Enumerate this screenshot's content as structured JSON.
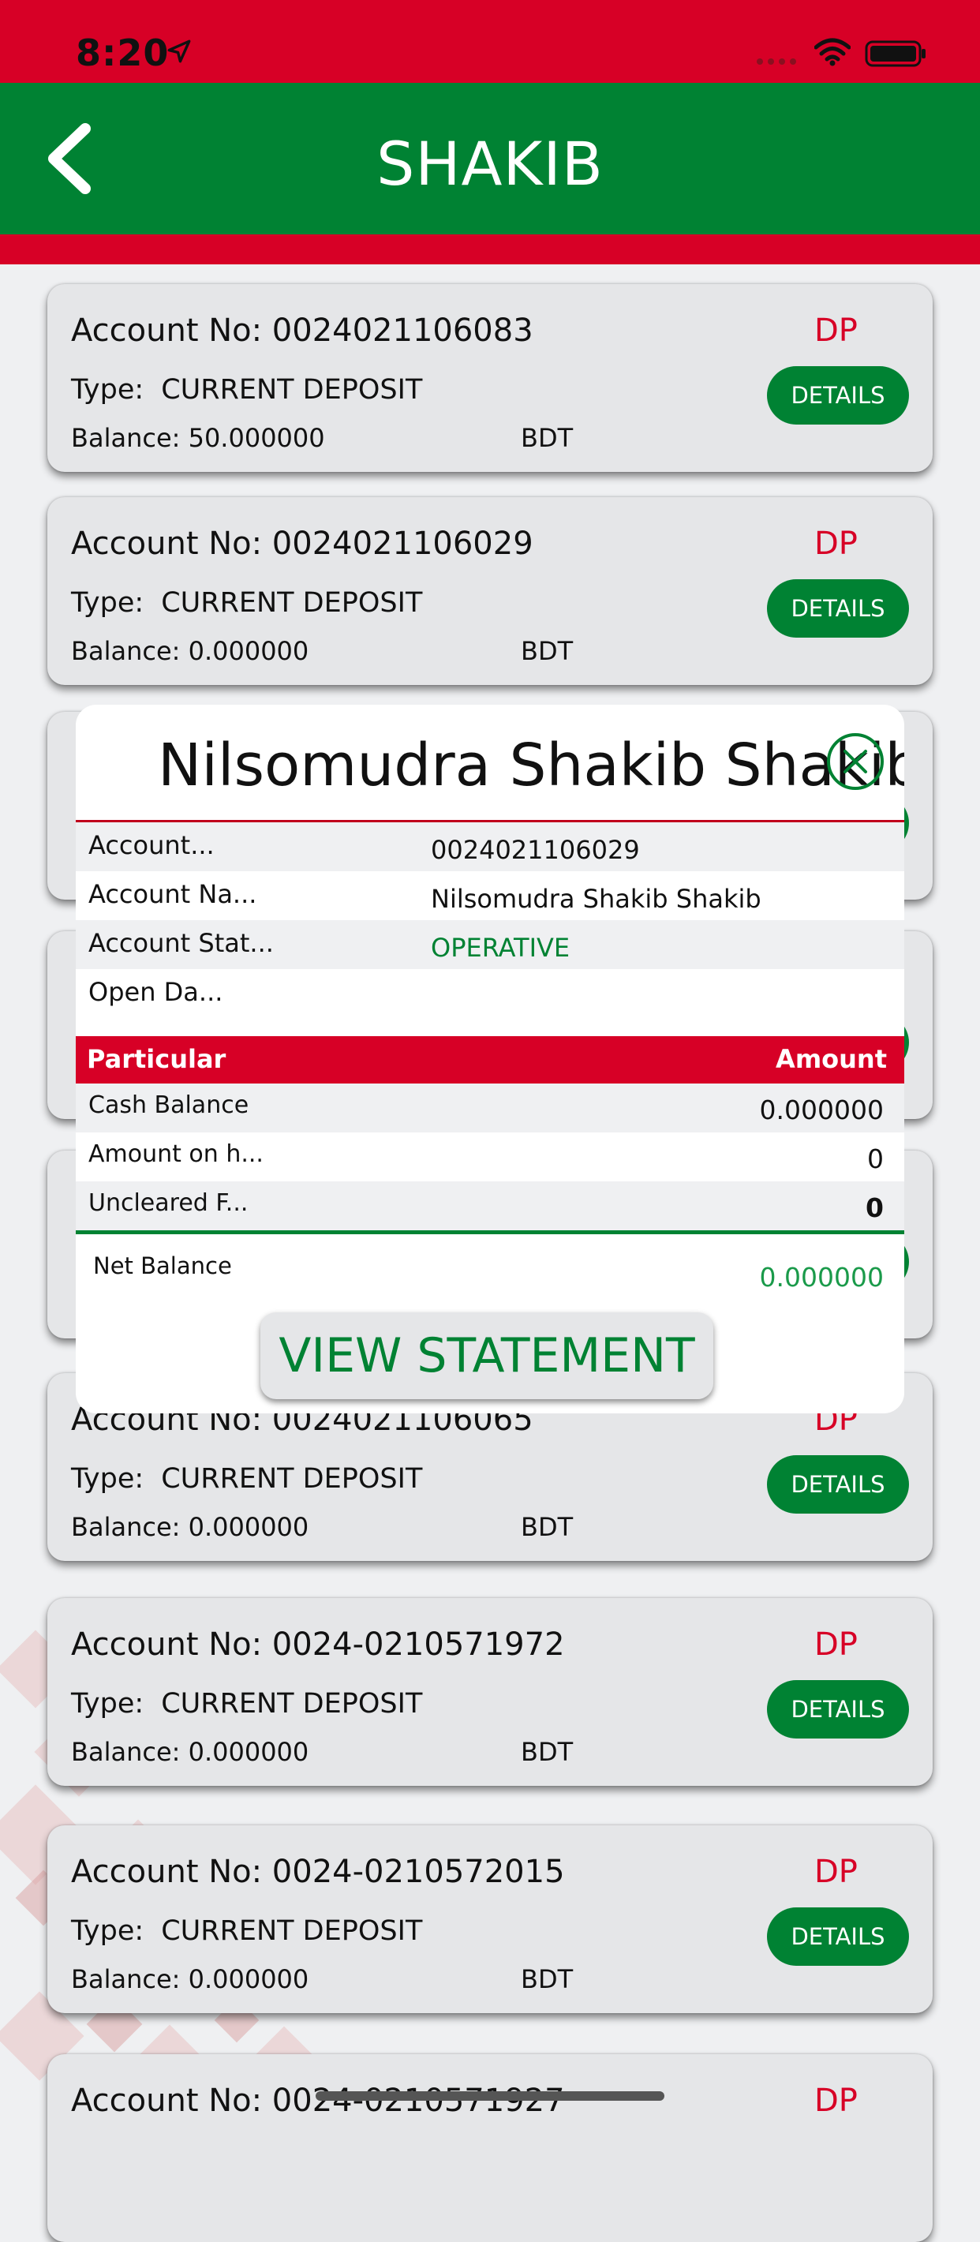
{
  "status_bar": {
    "time": "8:20"
  },
  "nav": {
    "title": "SHAKIB"
  },
  "accounts": [
    {
      "account_no": "Account No: 0024021106083",
      "type_label": "Type:",
      "type_value": "CURRENT DEPOSIT",
      "balance": "Balance: 50.000000",
      "currency": "BDT",
      "badge": "DP",
      "button": "DETAILS"
    },
    {
      "account_no": "Account No: 0024021106029",
      "type_label": "Type:",
      "type_value": "CURRENT DEPOSIT",
      "balance": "Balance: 0.000000",
      "currency": "BDT",
      "badge": "DP",
      "button": "DETAILS"
    },
    {
      "account_no": "Account No: 0024021106065",
      "type_label": "Type:",
      "type_value": "CURRENT DEPOSIT",
      "balance": "Balance: 0.000000",
      "currency": "BDT",
      "badge": "DP",
      "button": "DETAILS"
    },
    {
      "account_no": "Account No: 0024-0210571972",
      "type_label": "Type:",
      "type_value": "CURRENT DEPOSIT",
      "balance": "Balance: 0.000000",
      "currency": "BDT",
      "badge": "DP",
      "button": "DETAILS"
    },
    {
      "account_no": "Account No: 0024-0210572015",
      "type_label": "Type:",
      "type_value": "CURRENT DEPOSIT",
      "balance": "Balance: 0.000000",
      "currency": "BDT",
      "badge": "DP",
      "button": "DETAILS"
    },
    {
      "account_no": "Account No: 0024-0210571927",
      "badge": "DP"
    }
  ],
  "modal": {
    "title": "Nilsomudra Shakib Shakib",
    "info": [
      {
        "key": "Account...",
        "value": "0024021106029"
      },
      {
        "key": "Account Na...",
        "value": "Nilsomudra Shakib Shakib"
      },
      {
        "key": "Account Stat...",
        "value": "OPERATIVE"
      },
      {
        "key": "Open Da...",
        "value": ""
      }
    ],
    "table_header": {
      "particular": "Particular",
      "amount": "Amount"
    },
    "amounts": [
      {
        "key": "Cash Balance",
        "value": "0.000000"
      },
      {
        "key": "Amount on h...",
        "value": "0"
      },
      {
        "key": "Uncleared F...",
        "value": "0"
      }
    ],
    "net_balance_label": "Net Balance",
    "net_balance_value": "0.000000",
    "view_statement": "VIEW STATEMENT"
  },
  "colors": {
    "primary_green": "#008233",
    "primary_red": "#d70026"
  }
}
